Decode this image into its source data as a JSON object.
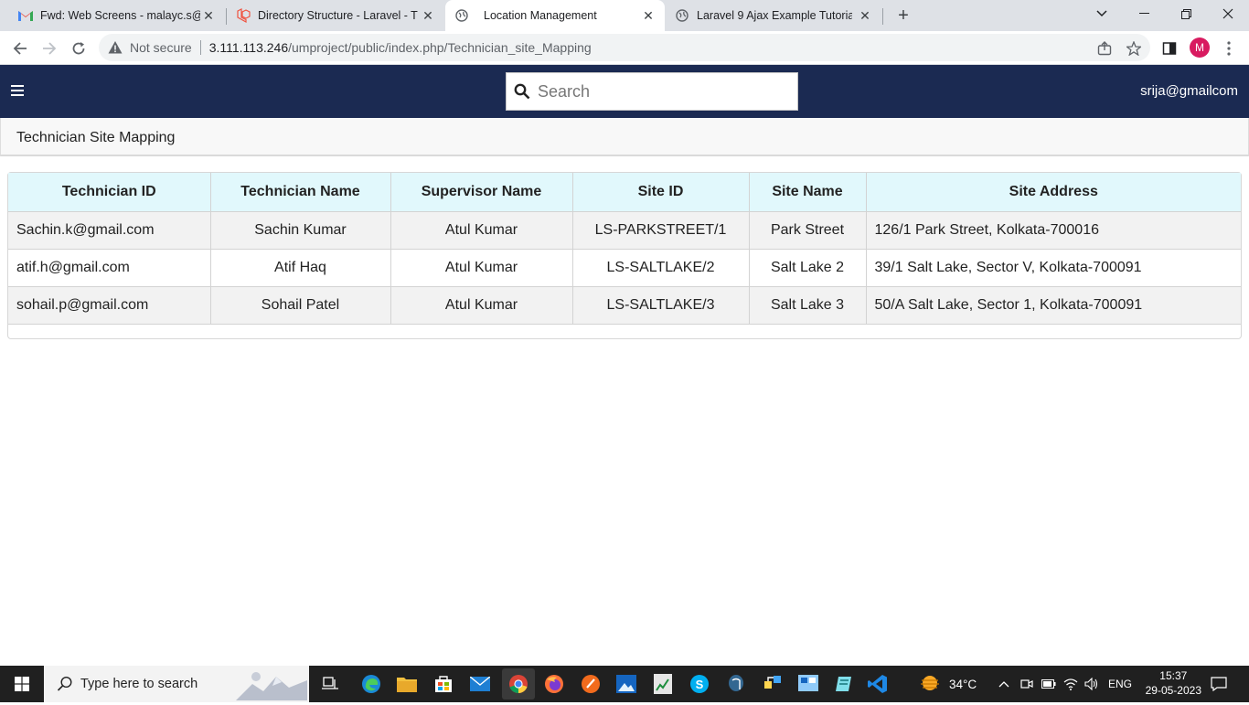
{
  "browser": {
    "tabs": [
      {
        "title": "Fwd: Web Screens - malayc.s@ac",
        "icon": "gmail-icon"
      },
      {
        "title": "Directory Structure - Laravel - The",
        "icon": "laravel-icon"
      },
      {
        "title": "Location Management",
        "icon": "globe-icon",
        "active": true
      },
      {
        "title": "Laravel 9 Ajax Example Tutorial: H",
        "icon": "globe-icon"
      }
    ],
    "security_label": "Not secure",
    "url_host": "3.111.113.246",
    "url_path": "/umproject/public/index.php/Technician_site_Mapping",
    "profile_initial": "M"
  },
  "header": {
    "search_placeholder": "Search",
    "user_email": "srija@gmailcom"
  },
  "page": {
    "title": "Technician Site Mapping"
  },
  "table": {
    "columns": [
      "Technician ID",
      "Technician Name",
      "Supervisor Name",
      "Site ID",
      "Site Name",
      "Site Address"
    ],
    "rows": [
      [
        "Sachin.k@gmail.com",
        "Sachin Kumar",
        "Atul Kumar",
        "LS-PARKSTREET/1",
        "Park Street",
        "126/1 Park Street, Kolkata-700016"
      ],
      [
        "atif.h@gmail.com",
        "Atif Haq",
        "Atul Kumar",
        "LS-SALTLAKE/2",
        "Salt Lake 2",
        "39/1 Salt Lake, Sector V, Kolkata-700091"
      ],
      [
        "sohail.p@gmail.com",
        "Sohail Patel",
        "Atul Kumar",
        "LS-SALTLAKE/3",
        "Salt Lake 3",
        "50/A Salt Lake, Sector 1, Kolkata-700091"
      ]
    ]
  },
  "taskbar": {
    "search_text": "Type here to search",
    "weather": "34°C",
    "language": "ENG",
    "time": "15:37",
    "date": "29-05-2023"
  },
  "colors": {
    "header_bg": "#1b2a52",
    "table_header_bg": "#e1f8fc"
  }
}
